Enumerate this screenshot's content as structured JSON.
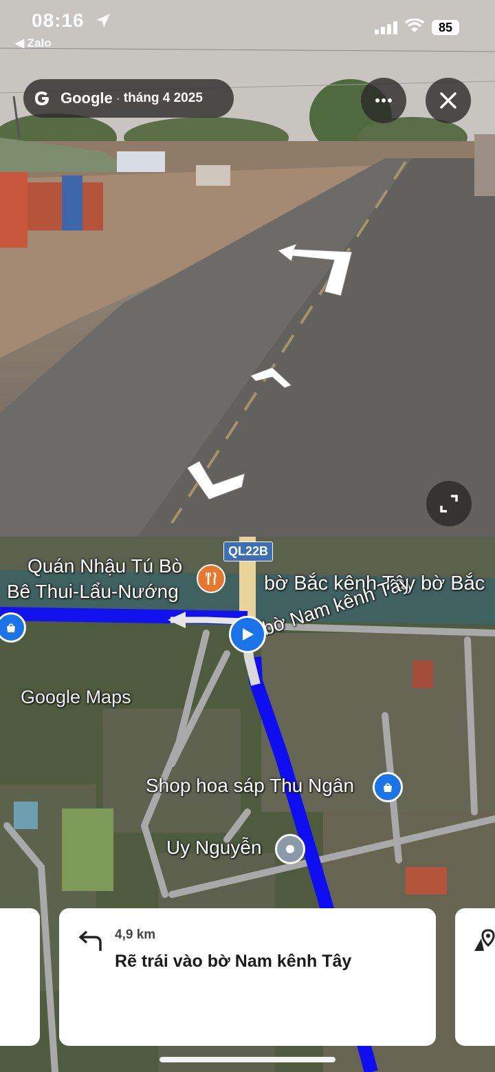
{
  "status_bar": {
    "time": "08:16",
    "back_app": "◀ Zalo",
    "battery": "85"
  },
  "street_view": {
    "brand": "Google",
    "date": "tháng 4 2025",
    "separator": "·",
    "buttons": [
      "more-button",
      "close-button",
      "expand-button"
    ]
  },
  "map": {
    "road_shield": "QL22B",
    "labels": {
      "restaurant_line1": "Quán Nhậu Tú Bò",
      "restaurant_line2": "Bê Thui-Lẩu-Nướng",
      "canal_north": "bờ Bắc kênh Tây bờ Bắc",
      "canal_south": "bờ Nam kênh Tây",
      "watermark": "Google Maps",
      "shop": "Shop hoa sáp Thu Ngân",
      "poi": "Uy Nguyễn"
    },
    "colors": {
      "route": "#1a1aff",
      "user_location": "#1a73e8",
      "food_pin": "#e8772e"
    }
  },
  "directions": {
    "distance": "4,9 km",
    "instruction": "Rẽ trái vào bờ Nam kênh Tây"
  }
}
